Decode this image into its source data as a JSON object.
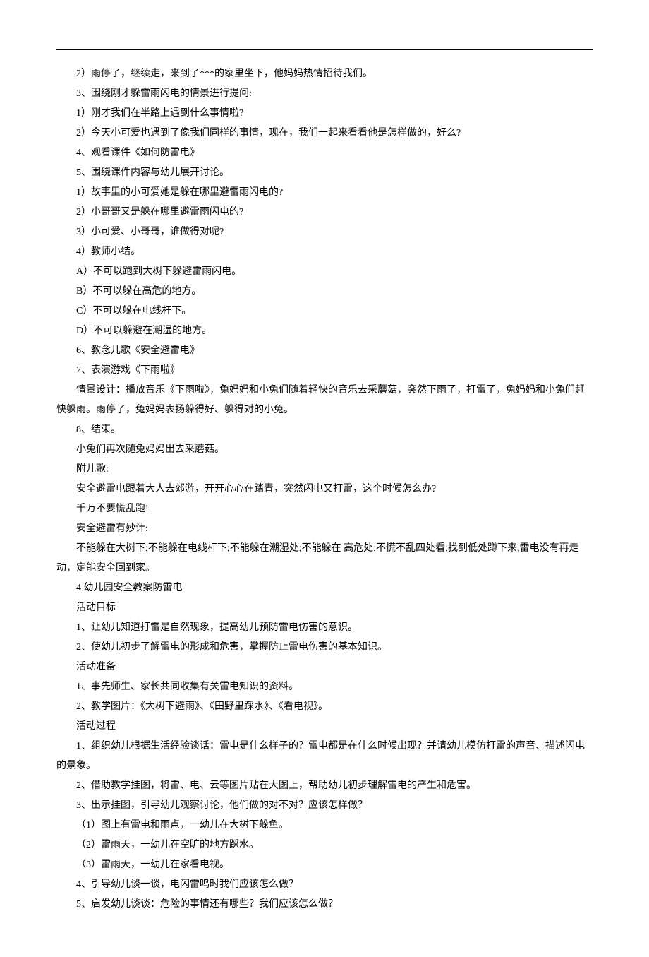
{
  "lines": [
    "2）雨停了，继续走，来到了***的家里坐下，他妈妈热情招待我们。",
    "3、围绕刚才躲雷雨闪电的情景进行提问:",
    "1）刚才我们在半路上遇到什么事情啦?",
    "2）今天小可爱也遇到了像我们同样的事情，现在，我们一起来看看他是怎样做的，好么?",
    "4、观看课件《如何防雷电》",
    "5、围绕课件内容与幼儿展开讨论。",
    "1）故事里的小可爱她是躲在哪里避雷雨闪电的?",
    "2）小哥哥又是躲在哪里避雷雨闪电的?",
    "3）小可爱、小哥哥，谁做得对呢?",
    "4）教师小结。",
    "A）不可以跑到大树下躲避雷雨闪电。",
    "B）不可以躲在高危的地方。",
    "C）不可以躲在电线杆下。",
    "D）不可以躲避在潮湿的地方。",
    "6、教念儿歌《安全避雷电》",
    "7、表演游戏《下雨啦》",
    "情景设计：播放音乐《下雨啦》，兔妈妈和小兔们随着轻快的音乐去采蘑菇，突然下雨了，打雷了，兔妈妈和小兔们赶快躲雨。雨停了，兔妈妈表扬躲得好、躲得对的小兔。",
    "8、结束。",
    "小兔们再次随兔妈妈出去采蘑菇。",
    "附儿歌:",
    "安全避雷电跟着大人去郊游，开开心心在踏青，突然闪电又打雷，这个时候怎么办?",
    "千万不要慌乱跑!",
    "安全避雷有妙计:",
    "不能躲在大树下;不能躲在电线杆下;不能躲在潮湿处;不能躲在 高危处;不慌不乱四处看;找到低处蹲下来,雷电没有再走动，定能安全回到家。",
    "4 幼儿园安全教案防雷电",
    "活动目标",
    "1、让幼儿知道打雷是自然现象，提高幼儿预防雷电伤害的意识。",
    "2、使幼儿初步了解雷电的形成和危害，掌握防止雷电伤害的基本知识。",
    "活动准备",
    "1、事先师生、家长共同收集有关雷电知识的资料。",
    "2、教学图片：《大树下避雨》、《田野里踩水》、《看电视》。",
    "活动过程",
    "1、组织幼儿根据生活经验谈话：雷电是什么样子的？雷电都是在什么时候出现？并请幼儿模仿打雷的声音、描述闪电的景象。",
    "2、借助教学挂图，将雷、电、云等图片贴在大图上，帮助幼儿初步理解雷电的产生和危害。",
    "3、出示挂图，引导幼儿观察讨论，他们做的对不对？应该怎样做？",
    "（1）图上有雷电和雨点，一幼儿在大树下躲鱼。",
    "（2）雷雨天，一幼儿在空旷的地方踩水。",
    "（3）雷雨天，一幼儿在家看电视。",
    "4、引导幼儿谈一谈，电闪雷鸣时我们应该怎么做？",
    "5、启发幼儿谈谈：危险的事情还有哪些？我们应该怎么做？"
  ]
}
